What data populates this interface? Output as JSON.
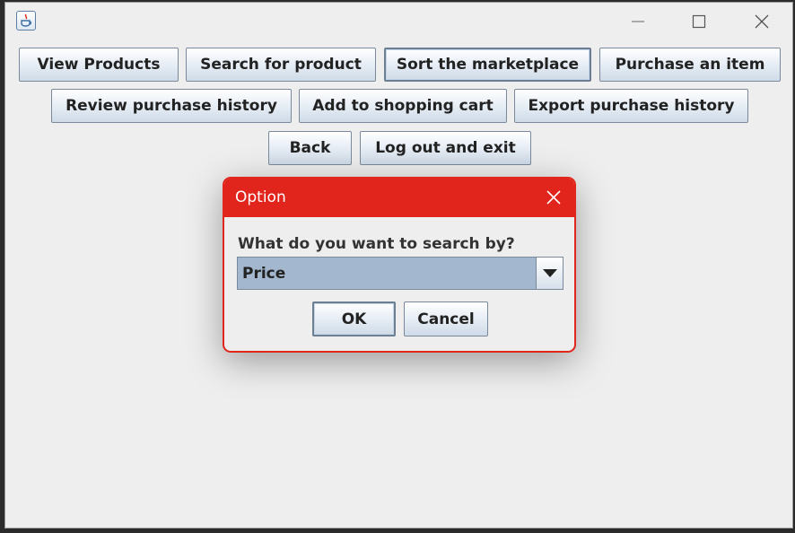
{
  "window": {
    "controls": {
      "minimize_icon": "minimize-icon",
      "maximize_icon": "maximize-icon",
      "close_icon": "close-icon"
    },
    "app_icon": "java-cup-icon"
  },
  "toolbar": {
    "row1": [
      "View Products",
      "Search for product",
      "Sort the marketplace",
      "Purchase an item"
    ],
    "row2": [
      "Review purchase history",
      "Add to shopping cart",
      "Export purchase history"
    ],
    "row3": [
      "Back",
      "Log out and exit"
    ]
  },
  "dialog": {
    "title": "Option",
    "prompt": "What do you want to search by?",
    "combo_value": "Price",
    "ok_label": "OK",
    "cancel_label": "Cancel",
    "accent_color": "#e2251c"
  },
  "colors": {
    "window_bg": "#eeeeee",
    "combo_bg": "#a3b7cf"
  }
}
